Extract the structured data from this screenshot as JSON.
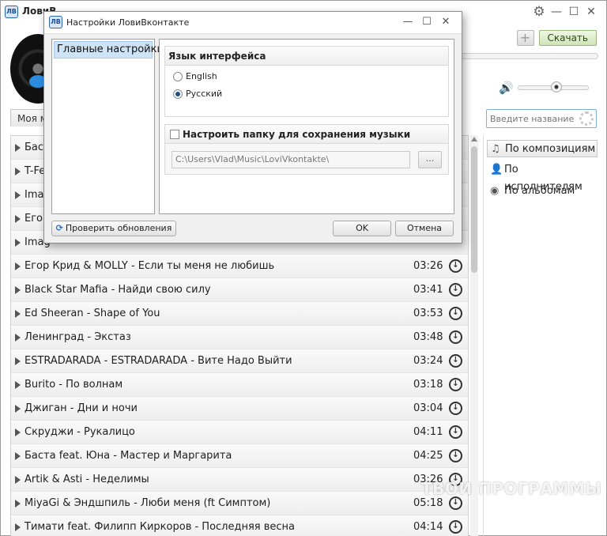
{
  "main_window": {
    "logo_text": "ЛВ",
    "title": "ЛовиВ",
    "win_controls": {
      "gear": "⚙",
      "minimize": "—",
      "maximize": "☐",
      "close": "✕"
    },
    "plus_label": "+",
    "download_label": "Скачать",
    "volume_icon": "🔊",
    "my_music_tab": "Моя м",
    "search": {
      "placeholder": "Введите название"
    }
  },
  "tracks": [
    {
      "title": "Баст",
      "duration": ""
    },
    {
      "title": "T-Fe",
      "duration": ""
    },
    {
      "title": "Imag",
      "duration": ""
    },
    {
      "title": "Егор",
      "duration": ""
    },
    {
      "title": "Imag",
      "duration": ""
    },
    {
      "title": "Егор Крид & MOLLY - Если ты меня не любишь",
      "duration": "03:26"
    },
    {
      "title": "Black Star Mafia - Найди свою силу",
      "duration": "03:41"
    },
    {
      "title": "Ed Sheeran - Shape of You",
      "duration": "03:53"
    },
    {
      "title": "Ленинград - Экстаз",
      "duration": "03:48"
    },
    {
      "title": "ESTRADARADA - ESTRADARADA - Вите Надо Выйти",
      "duration": "03:24"
    },
    {
      "title": "Burito - По волнам",
      "duration": "03:18"
    },
    {
      "title": "Джиган - Дни и ночи",
      "duration": "03:04"
    },
    {
      "title": "Скруджи - Рукалицо",
      "duration": "04:11"
    },
    {
      "title": "Баста feat. Юна - Мастер и Маргарита",
      "duration": "04:25"
    },
    {
      "title": "Artik & Asti - Неделимы",
      "duration": "03:26"
    },
    {
      "title": "MiyaGi & Эндшпиль - Люби меня (ft Симптом)",
      "duration": "05:18"
    },
    {
      "title": "Тимати feat. Филипп Киркоров - Последняя весна",
      "duration": "04:14"
    }
  ],
  "filters": [
    {
      "label": "По композициям",
      "icon": "♫",
      "active": true
    },
    {
      "label": "По исполнителям",
      "icon": "👤",
      "active": false
    },
    {
      "label": "По альбомам",
      "icon": "◉",
      "active": false
    }
  ],
  "watermark": "ТВОИ ПРОГРАММЫ РУ",
  "dialog": {
    "logo_text": "ЛВ",
    "title": "Настройки ЛовиВконтакте",
    "win_controls": {
      "minimize": "—",
      "maximize": "☐",
      "close": "✕"
    },
    "nav_items": [
      "Главные настройки"
    ],
    "language_group": {
      "title": "Язык интерфейса",
      "options": [
        {
          "label": "English",
          "selected": false
        },
        {
          "label": "Русский",
          "selected": true
        }
      ]
    },
    "folder_group": {
      "title": "Настроить папку для сохранения музыки",
      "path": "C:\\Users\\Vlad\\Music\\LoviVkontakte\\",
      "browse_label": "..."
    },
    "check_updates_label": "Проверить обновления",
    "ok_label": "OK",
    "cancel_label": "Отмена"
  }
}
